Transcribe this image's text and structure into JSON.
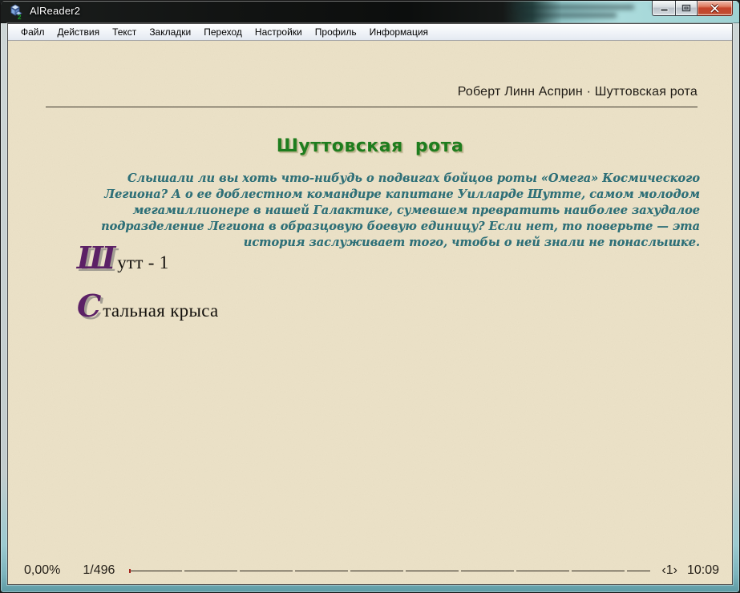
{
  "window": {
    "title": "AlReader2",
    "controls": {
      "minimize_icon": "minimize",
      "maximize_icon": "maximize-restore",
      "close_icon": "close"
    }
  },
  "menu": {
    "items": [
      "Файл",
      "Действия",
      "Текст",
      "Закладки",
      "Переход",
      "Настройки",
      "Профиль",
      "Информация"
    ]
  },
  "reader": {
    "page_header": "Роберт Линн Асприн · Шуттовская рота",
    "book_title": "Шуттовская рота",
    "annotation": "Слышали ли вы хоть что-нибудь о подвигах бойцов роты «Омега» Космического Легиона? А о ее доблестном командире капитане Уилларде Шутте, самом молодом мегамиллионере в нашей Галактике, сумевшем превратить наиболее захудалое подразделение Легиона в образцовую боевую единицу? Если нет, то поверьте — эта история заслуживает того, чтобы о ней знали не понаслышке.",
    "sections": [
      {
        "dropcap": "Ш",
        "rest": "утт - 1"
      },
      {
        "dropcap": "С",
        "rest": "тальная крыса"
      }
    ]
  },
  "statusbar": {
    "percent": "0,00%",
    "pages": "1/496",
    "chapter_indicator": "‹1›",
    "time": "10:09"
  },
  "colors": {
    "paper_background": "#EDE3C9",
    "title_green": "#1E7D1E",
    "annotation_teal": "#2F7078",
    "dropcap_purple": "#5C2166",
    "close_button_red": "#C6452C",
    "titlebar_glass_teal": "#9ED2D3"
  }
}
